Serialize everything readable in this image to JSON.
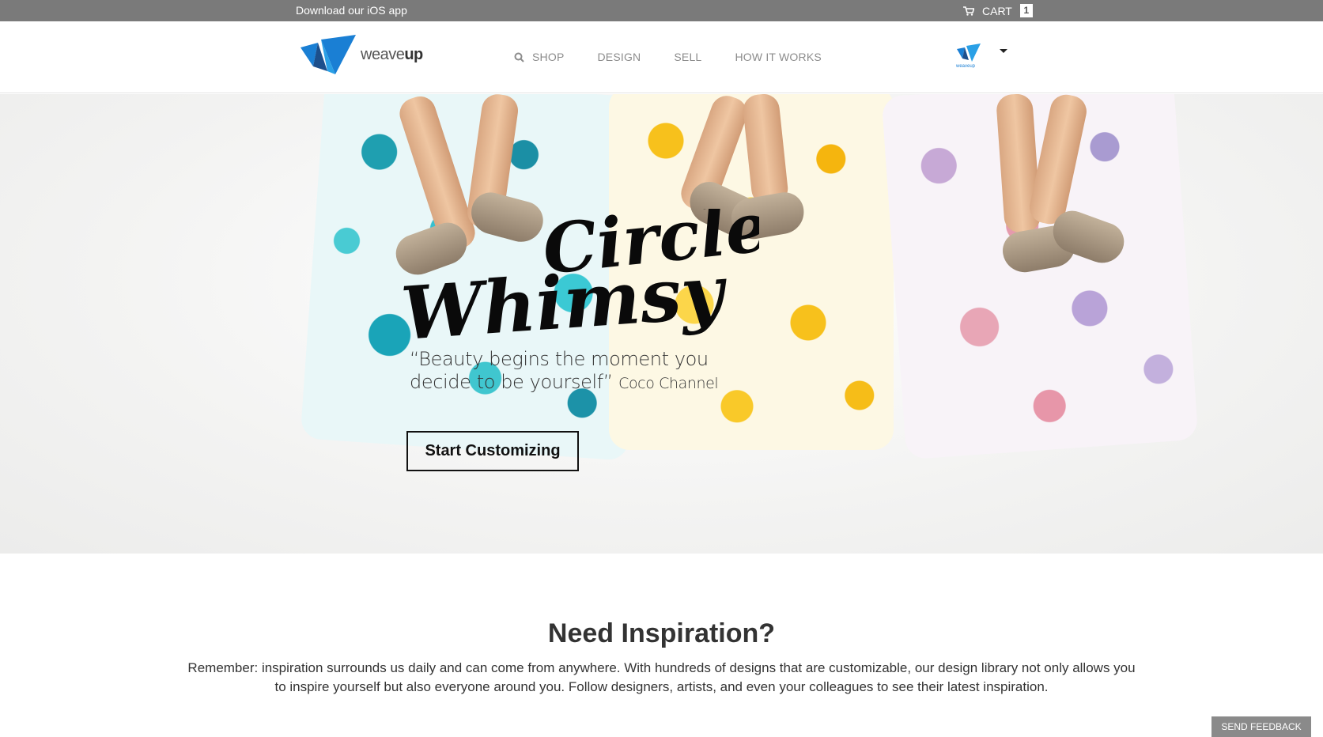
{
  "topbar": {
    "ios_link": "Download our iOS app",
    "cart_label": "CART",
    "cart_count": "1"
  },
  "header": {
    "logo_text_light": "weave",
    "logo_text_bold": "up",
    "nav": {
      "shop": "SHOP",
      "design": "DESIGN",
      "sell": "SELL",
      "how_it_works": "HOW IT WORKS"
    },
    "user_avatar_icon": "weaveup-logo-icon",
    "user_avatar_text": "weaveup"
  },
  "hero": {
    "script_line_1": "Circle",
    "script_line_2": "Whimsy",
    "quote": "“Beauty begins the moment you decide to be yourself”",
    "quote_author": "Coco Channel",
    "cta": "Start Customizing"
  },
  "inspiration": {
    "title": "Need Inspiration?",
    "text": "Remember: inspiration surrounds us daily and can come from anywhere. With hundreds of designs that are customizable, our design library not only allows you to inspire yourself but also everyone around you. Follow designers, artists, and even your colleagues to see their latest inspiration."
  },
  "feedback_label": "SEND FEEDBACK",
  "colors": {
    "topbar_bg": "#7a7a7a",
    "logo_blue": "#1a7fd4",
    "logo_dark": "#1c4f8c",
    "nav_text": "#8c8c8c"
  }
}
